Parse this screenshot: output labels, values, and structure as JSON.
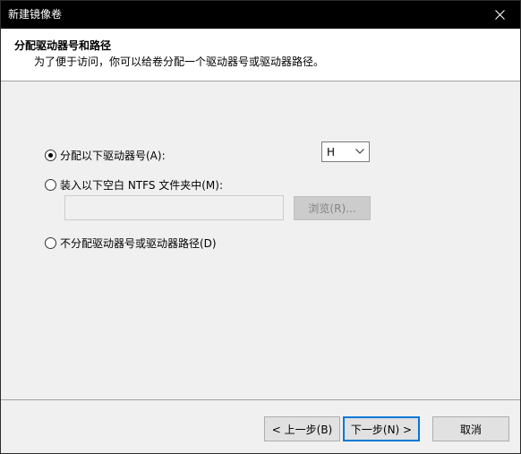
{
  "window": {
    "title": "新建镜像卷"
  },
  "header": {
    "title": "分配驱动器号和路径",
    "subtitle": "为了便于访问，你可以给卷分配一个驱动器号或驱动器路径。"
  },
  "options": {
    "assign_letter": {
      "label": "分配以下驱动器号(A):",
      "checked": true
    },
    "mount_folder": {
      "label": "装入以下空白 NTFS 文件夹中(M):",
      "checked": false
    },
    "no_assign": {
      "label": "不分配驱动器号或驱动器路径(D)",
      "checked": false
    }
  },
  "drive_letter": {
    "selected": "H"
  },
  "folder_path": {
    "value": ""
  },
  "buttons": {
    "browse": "浏览(R)...",
    "back": "< 上一步(B)",
    "next": "下一步(N) >",
    "cancel": "取消"
  },
  "icons": {
    "close": "close-icon",
    "dropdown": "chevron-down-icon"
  }
}
